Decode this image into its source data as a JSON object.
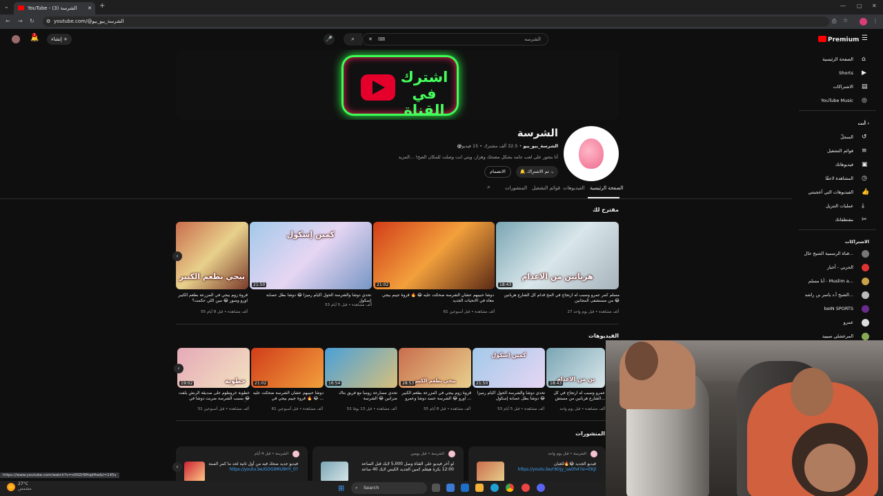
{
  "browser": {
    "tab_title": "YouTube - (3) الشرسة",
    "url": "youtube.com/@الشرسة_بيو_بيو",
    "status_url": "https://www.youtube.com/watch?v=n00ZrNHqdHw&t=145s"
  },
  "header": {
    "logo": "Premium",
    "search_value": "الشرسه",
    "create_label": "إنشاء",
    "notif_count": "3"
  },
  "sidebar": {
    "main": [
      {
        "label": "الصفحة الرئيسية",
        "icon": "home-icon"
      },
      {
        "label": "Shorts",
        "icon": "shorts-icon"
      },
      {
        "label": "الاشتراكات",
        "icon": "subscriptions-icon"
      },
      {
        "label": "YouTube Music",
        "icon": "music-icon"
      }
    ],
    "you_header": "أنت",
    "you": [
      {
        "label": "السجلّ",
        "icon": "history-icon"
      },
      {
        "label": "قوائم التشغيل",
        "icon": "playlist-icon"
      },
      {
        "label": "فيديوهاتك",
        "icon": "your-videos-icon"
      },
      {
        "label": "المشاهدة لاحقًا",
        "icon": "watch-later-icon"
      },
      {
        "label": "الفيديوهات التي أعجبتني",
        "icon": "like-icon"
      },
      {
        "label": "عمليات التنزيل",
        "icon": "download-icon"
      },
      {
        "label": "مقتطفاتك",
        "icon": "clips-icon"
      }
    ],
    "subs_header": "الاشتراكات",
    "subs": [
      {
        "label": "قناة الرسمية الشيخ خال..."
      },
      {
        "label": "الحربي - أخبار"
      },
      {
        "label": "أنا مسلم - Muslim a..."
      },
      {
        "label": "الشيخ أ.د ياسر بن راشد..."
      },
      {
        "label": "beIN SPORTS"
      },
      {
        "label": "عمرو"
      },
      {
        "label": "المرعشلي سيبيد"
      }
    ]
  },
  "channel": {
    "name": "الشرسة",
    "handle": "@الشرسة_بيو_بيو",
    "meta": "32.5 ألف مشترك • 15 فيديو",
    "description": "أنا بتحور على لعب جامد بشكل مضحك وهزار، وبتي انت وصلت للمكان الصح! ...المزيد",
    "subscribed_label": "تم الاشتراك",
    "join_label": "الانضمام",
    "banner_text": "اشترك في القناة"
  },
  "tabs": [
    "الصفحة الرئيسية",
    "الفيديوهات",
    "قوائم التشغيل",
    "المنشورات"
  ],
  "sections": {
    "for_you": "مقترح لك",
    "videos": "الفيديوهات",
    "posts": "المنشورات"
  },
  "for_you": [
    {
      "title": "مسلم كمر عمرو وسبب له ارتجاج في المخ قدام كل الشارع هربانين من مستشفى المجانين 😂",
      "meta": "27 ألف مشاهدة • قبل يوم واحد",
      "duration": "18:43",
      "overlay": "هربانين من الاعدام"
    },
    {
      "title": "دوشا حبيبهم عشان الشرسة ضحكت عليه 😂 🔥 قروة جيبم بيجي معاه في الانحيات الجديد",
      "meta": "61 ألف مشاهدة • قبل أسبوعين",
      "duration": "21:02",
      "overlay": ""
    },
    {
      "title": "تحدي دوشا والشرسة الحول اكيام رميزا 😂 دوشا بطل عصابة إسكول",
      "meta": "53 ألف مشاهدة • قبل 5 أيام",
      "duration": "21:50",
      "overlay": "كمين إسكول"
    },
    {
      "title": "قروة زوم بيجي في المزرعة بطعم الكبير اورو وصور 😂 مين اللي حكمت؟",
      "meta": "55 ألف مشاهدة • قبل 8 أيام",
      "duration": "",
      "overlay": "بيجي بطعم الكبير"
    }
  ],
  "videos": [
    {
      "title": "عمرو وسبب له ارتجاج في كل الشارع هربانين من مستش...",
      "meta": "ألف مشاهدة • قبل يوم واحد",
      "duration": "18:43",
      "overlay": "ين من الاعدام"
    },
    {
      "title": "تحدي دوشا والشرسة الحول اكيام رميزا 😂 دوشا بطل عصابة إسكول",
      "meta": "53 ألف مشاهدة • قبل 5 أيام",
      "duration": "21:50",
      "overlay": "كمين إسكول"
    },
    {
      "title": "قروة زوم بيجي في المزرعة بطعم الكبير اورو 😂 الشرسة حسد دوشا وعمرو ...",
      "meta": "55 ألف مشاهدة • قبل 8 أيام",
      "duration": "28:53",
      "overlay": "بيجي بطعم الكبير"
    },
    {
      "title": "تحدي مسارعة زومبا مع فريق بتاك ضرانين 😂 الشرسة",
      "meta": "52 ألف مشاهدة • قبل 13 يومًا",
      "duration": "16:54",
      "overlay": ""
    },
    {
      "title": "دوشا حبيبهم عشان الشرسة ضحكت عليه 😂 🔥 قروة جيبم بيجي في ...",
      "meta": "61 ألف مشاهدة • قبل أسبوعين",
      "duration": "21:02",
      "overlay": ""
    },
    {
      "title": "خطوبة خروطوم على صديقة الرنش يلفت 😂 بسبب الشرسة ضربت دوشا في أكبر...",
      "meta": "51 ألف مشاهدة • قبل أسبوعين",
      "duration": "19:02",
      "overlay": "خطوبة"
    }
  ],
  "posts": [
    {
      "meta": "الشرسة • قبل 4 أيام",
      "text": "فيديو جديد ضحك فيه من أول ثانية لحد ما كمر السنة",
      "link": "https://youtu.be/GOG9MU9HY_0?"
    },
    {
      "meta": "الشرسة • قبل يومين",
      "text": "لو آخر فيديو على القناة وصل 5,000 لايك قبل الساعة 12:00 بكرة هيقلم كمين الجديد الكيس لايك 40 ساعة",
      "link": ""
    },
    {
      "meta": "الشرسة • قبل يوم واحد",
      "text": "فيديو الجديد 😂🔥للعيان",
      "link": "https://youtu.be/r9Ojy_uaOh4?si=EKJl"
    }
  ],
  "taskbar": {
    "search_label": "Search",
    "temp": "27°C",
    "weather": "مشمس"
  }
}
